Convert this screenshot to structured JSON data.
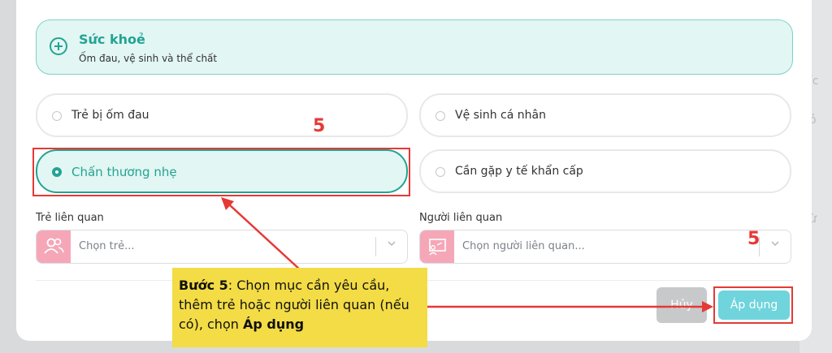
{
  "category": {
    "title": "Sức khoẻ",
    "subtitle": "Ốm đau, vệ sinh và thể chất",
    "icon": "medical-plus-icon"
  },
  "options": [
    {
      "label": "Trẻ bị ốm đau",
      "selected": false
    },
    {
      "label": "Vệ sinh cá nhân",
      "selected": false
    },
    {
      "label": "Chấn thương nhẹ",
      "selected": true
    },
    {
      "label": "Cần gặp y tế khẩn cấp",
      "selected": false
    }
  ],
  "child_field": {
    "label": "Trẻ liên quan",
    "placeholder": "Chọn trẻ...",
    "icon": "users-icon"
  },
  "person_field": {
    "label": "Người liên quan",
    "placeholder": "Chọn người liên quan...",
    "icon": "presenter-icon"
  },
  "buttons": {
    "cancel": "Hủy",
    "apply": "Áp dụng"
  },
  "annotation": {
    "step_marker": "5",
    "step_marker_2": "5",
    "callout_prefix": "Bước 5",
    "callout_body": ": Chọn mục cần yêu cầu, thêm trẻ hoặc người liên quan (nếu có), chọn ",
    "callout_suffix": "Áp dụng",
    "color": "#e53935",
    "callout_bg": "#f3dc45"
  },
  "colors": {
    "accent": "#23a393",
    "accent_bg": "#e2f6f3",
    "apply_button": "#6fd4dc",
    "field_icon_bg": "#f5a7b8"
  }
}
